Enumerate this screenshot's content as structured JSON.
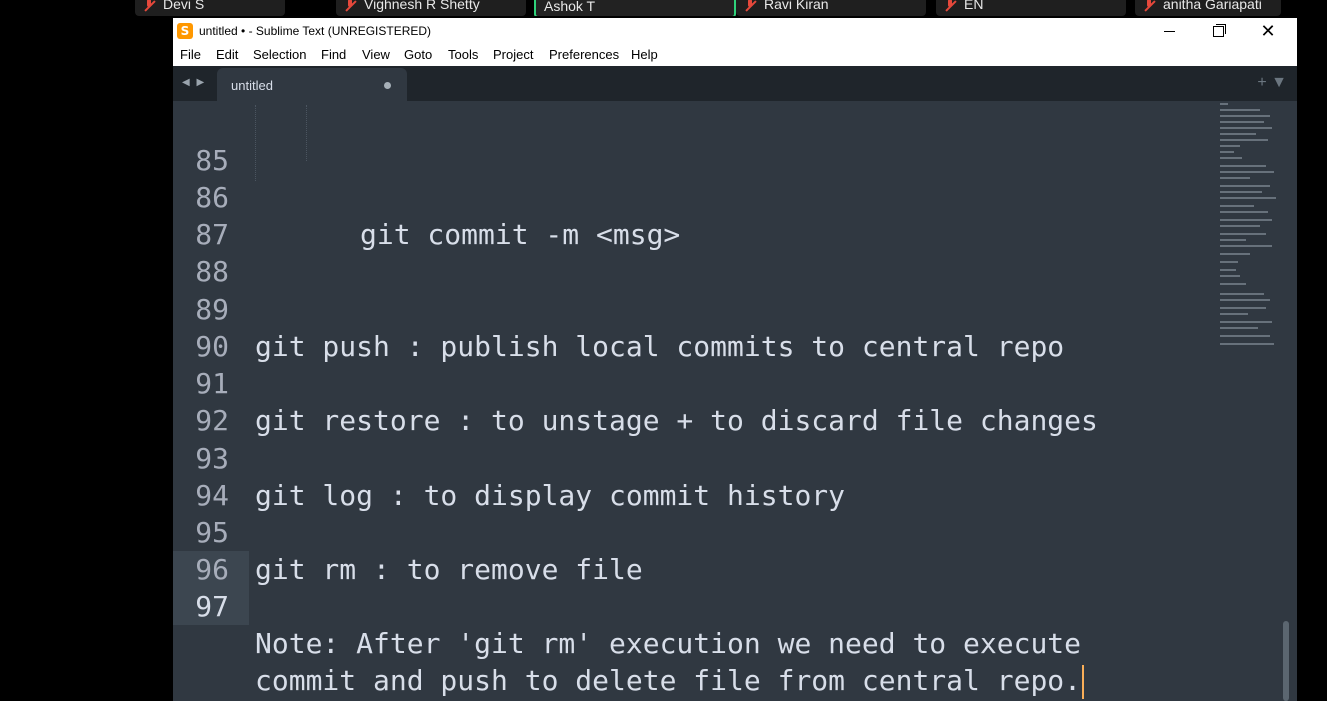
{
  "meeting": {
    "participants": [
      {
        "name": "Devi S",
        "muted": true
      },
      {
        "name": "Vighnesh R Shetty",
        "muted": true
      },
      {
        "name": "Ashok T",
        "muted": false,
        "active_speaker": true
      },
      {
        "name": "Ravi Kiran",
        "muted": true
      },
      {
        "name": "EN",
        "muted": true
      },
      {
        "name": "anitha Gariapati",
        "muted": true
      }
    ]
  },
  "window": {
    "title": "untitled • - Sublime Text (UNREGISTERED)",
    "app_icon": "sublime-text-icon",
    "controls": {
      "minimize": "minimize-icon",
      "maximize": "restore-icon",
      "close": "close-icon"
    }
  },
  "menu": [
    "File",
    "Edit",
    "Selection",
    "Find",
    "View",
    "Goto",
    "Tools",
    "Project",
    "Preferences",
    "Help"
  ],
  "tabs": {
    "nav": "◀ ▶",
    "active": {
      "label": "untitled",
      "dirty": true
    },
    "actions": "+ ▼"
  },
  "editor": {
    "current_line": 97,
    "lines": [
      {
        "num": "85",
        "text": ""
      },
      {
        "num": "86",
        "text": "git commit -m <msg>"
      },
      {
        "num": "87",
        "text": ""
      },
      {
        "num": "88",
        "text": ""
      },
      {
        "num": "89",
        "text": "git push : publish local commits to central repo"
      },
      {
        "num": "90",
        "text": ""
      },
      {
        "num": "91",
        "text": "git restore : to unstage + to discard file changes"
      },
      {
        "num": "92",
        "text": ""
      },
      {
        "num": "93",
        "text": "git log : to display commit history"
      },
      {
        "num": "94",
        "text": ""
      },
      {
        "num": "95",
        "text": "git rm : to remove file"
      },
      {
        "num": "96",
        "text": ""
      },
      {
        "num": "97",
        "text": "Note: After 'git rm' execution we need to execute"
      },
      {
        "num": "",
        "text": "commit and push to delete file from central repo."
      }
    ]
  },
  "colors": {
    "editor_bg": "#303841",
    "tabbar_bg": "#1f252b",
    "text": "#d8dee9",
    "cursor": "#f9ae58",
    "active_speaker_border": "#2fd27b",
    "muted_mic": "#e5483b"
  }
}
